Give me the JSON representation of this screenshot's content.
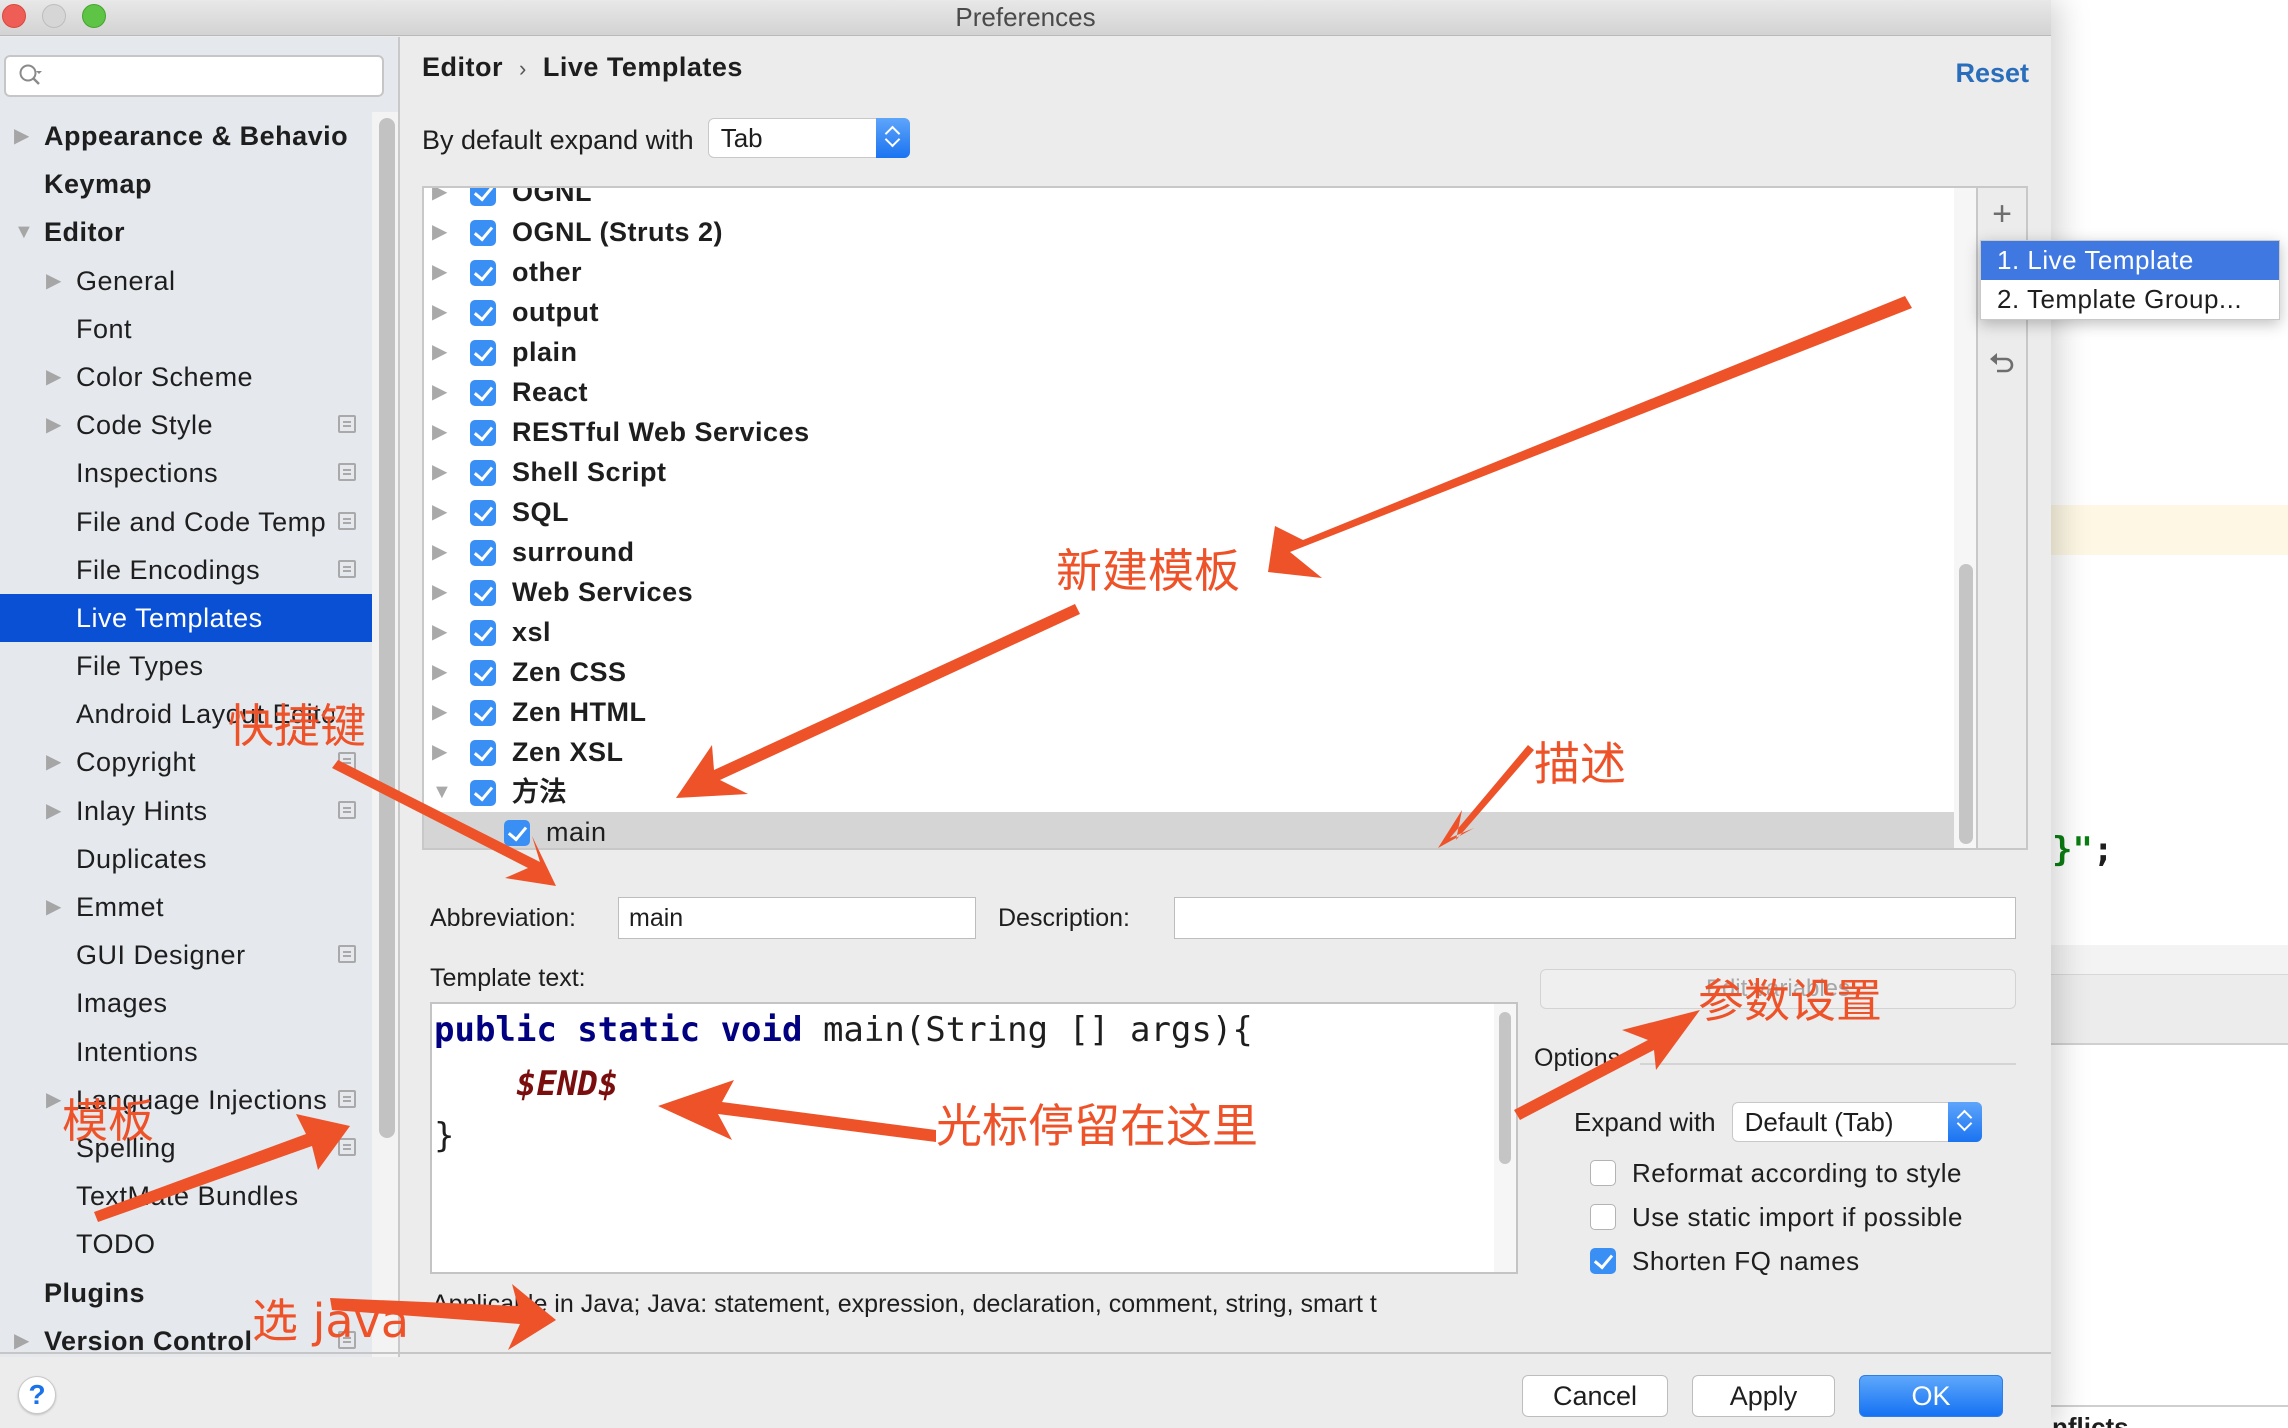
{
  "window": {
    "title": "Preferences"
  },
  "sidebar": {
    "search_placeholder": "",
    "items": [
      {
        "label": "Appearance & Behavio",
        "level": 0,
        "bold": true,
        "arrow": "right"
      },
      {
        "label": "Keymap",
        "level": 0,
        "bold": true,
        "arrow": ""
      },
      {
        "label": "Editor",
        "level": 0,
        "bold": true,
        "arrow": "down"
      },
      {
        "label": "General",
        "level": 1,
        "arrow": "right"
      },
      {
        "label": "Font",
        "level": 1,
        "arrow": ""
      },
      {
        "label": "Color Scheme",
        "level": 1,
        "arrow": "right"
      },
      {
        "label": "Code Style",
        "level": 1,
        "arrow": "right",
        "project_icon": true
      },
      {
        "label": "Inspections",
        "level": 1,
        "arrow": "",
        "project_icon": true
      },
      {
        "label": "File and Code Temp",
        "level": 1,
        "arrow": "",
        "project_icon": true
      },
      {
        "label": "File Encodings",
        "level": 1,
        "arrow": "",
        "project_icon": true
      },
      {
        "label": "Live Templates",
        "level": 1,
        "arrow": "",
        "selected": true
      },
      {
        "label": "File Types",
        "level": 1,
        "arrow": ""
      },
      {
        "label": "Android Layout Editor",
        "level": 1,
        "arrow": ""
      },
      {
        "label": "Copyright",
        "level": 1,
        "arrow": "right",
        "project_icon": true
      },
      {
        "label": "Inlay Hints",
        "level": 1,
        "arrow": "right",
        "project_icon": true
      },
      {
        "label": "Duplicates",
        "level": 1,
        "arrow": ""
      },
      {
        "label": "Emmet",
        "level": 1,
        "arrow": "right"
      },
      {
        "label": "GUI Designer",
        "level": 1,
        "arrow": "",
        "project_icon": true
      },
      {
        "label": "Images",
        "level": 1,
        "arrow": ""
      },
      {
        "label": "Intentions",
        "level": 1,
        "arrow": ""
      },
      {
        "label": "Language Injections",
        "level": 1,
        "arrow": "right",
        "project_icon": true
      },
      {
        "label": "Spelling",
        "level": 1,
        "arrow": "",
        "project_icon": true
      },
      {
        "label": "TextMate Bundles",
        "level": 1,
        "arrow": ""
      },
      {
        "label": "TODO",
        "level": 1,
        "arrow": ""
      },
      {
        "label": "Plugins",
        "level": 0,
        "bold": true,
        "arrow": ""
      },
      {
        "label": "Version Control",
        "level": 0,
        "bold": true,
        "arrow": "right",
        "project_icon": true
      }
    ]
  },
  "header": {
    "breadcrumb": [
      "Editor",
      "Live Templates"
    ],
    "breadcrumb_separator": "›",
    "reset_label": "Reset"
  },
  "expand_default": {
    "label": "By default expand with",
    "value": "Tab"
  },
  "template_groups": [
    {
      "name": "OGNL",
      "checked": true,
      "expanded": false
    },
    {
      "name": "OGNL (Struts 2)",
      "checked": true,
      "expanded": false
    },
    {
      "name": "other",
      "checked": true,
      "expanded": false
    },
    {
      "name": "output",
      "checked": true,
      "expanded": false
    },
    {
      "name": "plain",
      "checked": true,
      "expanded": false
    },
    {
      "name": "React",
      "checked": true,
      "expanded": false
    },
    {
      "name": "RESTful Web Services",
      "checked": true,
      "expanded": false
    },
    {
      "name": "Shell Script",
      "checked": true,
      "expanded": false
    },
    {
      "name": "SQL",
      "checked": true,
      "expanded": false
    },
    {
      "name": "surround",
      "checked": true,
      "expanded": false
    },
    {
      "name": "Web Services",
      "checked": true,
      "expanded": false
    },
    {
      "name": "xsl",
      "checked": true,
      "expanded": false
    },
    {
      "name": "Zen CSS",
      "checked": true,
      "expanded": false
    },
    {
      "name": "Zen HTML",
      "checked": true,
      "expanded": false
    },
    {
      "name": "Zen XSL",
      "checked": true,
      "expanded": false
    },
    {
      "name": "方法",
      "checked": true,
      "expanded": true,
      "children": [
        {
          "name": "main",
          "checked": true,
          "selected": true
        }
      ]
    }
  ],
  "toolbar": {
    "add_icon": "plus-icon",
    "copy_icon": "copy-icon",
    "revert_icon": "undo-icon"
  },
  "add_popup": {
    "items": [
      "1. Live Template",
      "2. Template Group..."
    ],
    "active_index": 0
  },
  "editor": {
    "abbreviation_label": "Abbreviation:",
    "abbreviation_value": "main",
    "description_label": "Description:",
    "description_value": "",
    "template_text_label": "Template text:",
    "template_code": {
      "line1_keywords": "public static void",
      "line1_rest": " main(String [] args){",
      "line2_variable": "$END$",
      "line3": "}"
    },
    "edit_variables_label": "Edit variables",
    "applicable": "Applicable in Java; Java: statement, expression, declaration, comment, string, smart t"
  },
  "options": {
    "title": "Options",
    "expand_with_label": "Expand with",
    "expand_with_value": "Default (Tab)",
    "checkboxes": [
      {
        "label": "Reformat according to style",
        "checked": false
      },
      {
        "label": "Use static import if possible",
        "checked": false
      },
      {
        "label": "Shorten FQ names",
        "checked": true
      }
    ]
  },
  "footer": {
    "help": "?",
    "cancel": "Cancel",
    "apply": "Apply",
    "ok": "OK"
  },
  "annotations": {
    "new_template": "新建模板",
    "shortcut": "快捷键",
    "description": "描述",
    "params": "参数设置",
    "cursor_here": "光标停留在这里",
    "template": "模板",
    "choose_java": "选 java"
  },
  "background_editor": {
    "code_fragment_brace": "}\"",
    "code_fragment_semicolon": ";",
    "bottom_text": "nflicts"
  },
  "colors": {
    "accent": "#0a50d4",
    "annotation": "#ee5229",
    "checkbox": "#3a8ff5",
    "link": "#2a6ebb"
  }
}
